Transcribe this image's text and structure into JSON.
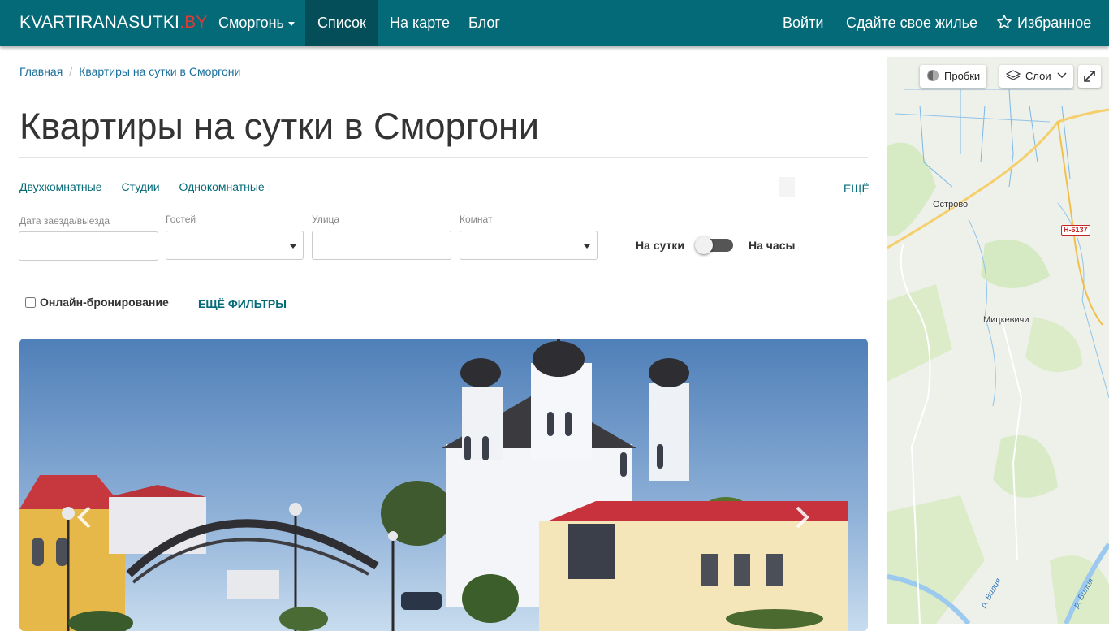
{
  "nav": {
    "brand": "KVARTIRANASUTKI",
    "brand_tld": ".BY",
    "city": "Сморгонь",
    "list": "Список",
    "on_map": "На карте",
    "blog": "Блог",
    "login": "Войти",
    "rent_out": "Сдайте свое жилье",
    "favorites": "Избранное"
  },
  "breadcrumb": {
    "home": "Главная",
    "separator": "/",
    "current": "Квартиры на сутки в Сморгони"
  },
  "page_title": "Квартиры на сутки в Сморгони",
  "quick_links": [
    "Двухкомнатные",
    "Студии",
    "Однокомнатные"
  ],
  "quick_more": "ЕЩЁ",
  "filters": {
    "dates_label": "Дата заезда/выезда",
    "dates_value": "",
    "guests_label": "Гостей",
    "guests_value": "",
    "street_label": "Улица",
    "street_value": "",
    "rooms_label": "Комнат",
    "rooms_value": ""
  },
  "rental_toggle": {
    "left": "На сутки",
    "right": "На часы",
    "state": "На сутки"
  },
  "online_booking": "Онлайн-бронирование",
  "more_filters": "ЕЩЁ ФИЛЬТРЫ",
  "map": {
    "traffic": "Пробки",
    "layers": "Слои",
    "places": {
      "ostrovo": "Острово",
      "mitskevichi": "Мицкевичи"
    },
    "road": "Н-6137",
    "river_1": "р. Вилия",
    "river_2": "р. Вилия"
  },
  "colors": {
    "navbar": "#046a78",
    "navbar_active": "#034e58",
    "accent_link": "#046a78",
    "breadcrumb_link": "#1a6f9c",
    "brand_tld": "#e53935"
  }
}
